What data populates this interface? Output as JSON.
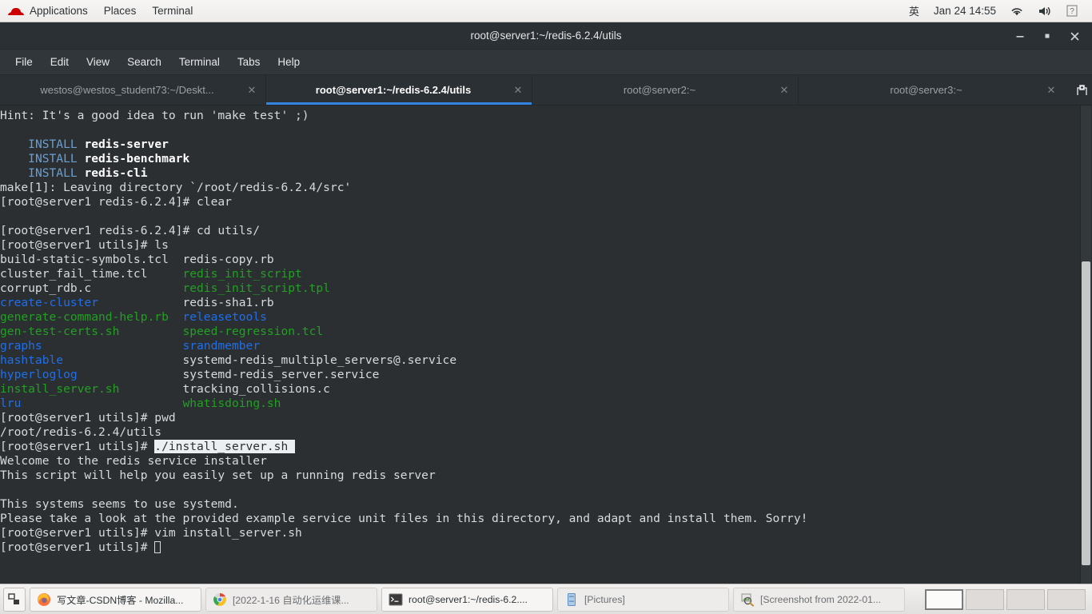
{
  "gnome_panel": {
    "logo": "redhat-logo",
    "menus": [
      "Applications",
      "Places",
      "Terminal"
    ],
    "ime": "英",
    "clock": "Jan 24 14:55",
    "tray_icons": [
      "wifi-icon",
      "volume-icon",
      "help-icon"
    ]
  },
  "window": {
    "title": "root@server1:~/redis-6.2.4/utils",
    "buttons": {
      "minimize": "_",
      "maximize": "□",
      "close": "✕"
    }
  },
  "menubar": [
    "File",
    "Edit",
    "View",
    "Search",
    "Terminal",
    "Tabs",
    "Help"
  ],
  "tabs": [
    {
      "label": "westos@westos_student73:~/Deskt...",
      "active": false
    },
    {
      "label": "root@server1:~/redis-6.2.4/utils",
      "active": true
    },
    {
      "label": "root@server2:~",
      "active": false
    },
    {
      "label": "root@server3:~",
      "active": false
    }
  ],
  "tab_actions": {
    "new_tab": "new-tab-icon",
    "tab_menu": "chevron-down-icon"
  },
  "terminal": {
    "lines": [
      [
        {
          "t": "Hint: It's a good idea to run 'make test' ;)"
        }
      ],
      [
        {
          "t": ""
        }
      ],
      [
        {
          "t": "    "
        },
        {
          "t": "INSTALL ",
          "c": "c-ltblue"
        },
        {
          "t": "redis-server",
          "c": "c-white b"
        }
      ],
      [
        {
          "t": "    "
        },
        {
          "t": "INSTALL ",
          "c": "c-ltblue"
        },
        {
          "t": "redis-benchmark",
          "c": "c-white b"
        }
      ],
      [
        {
          "t": "    "
        },
        {
          "t": "INSTALL ",
          "c": "c-ltblue"
        },
        {
          "t": "redis-cli",
          "c": "c-white b"
        }
      ],
      [
        {
          "t": "make[1]: Leaving directory `/root/redis-6.2.4/src'"
        }
      ],
      [
        {
          "t": "[root@server1 redis-6.2.4]# clear"
        }
      ],
      [
        {
          "t": ""
        }
      ],
      [
        {
          "t": "[root@server1 redis-6.2.4]# cd utils/"
        }
      ],
      [
        {
          "t": "[root@server1 utils]# ls"
        }
      ],
      [
        {
          "t": "build-static-symbols.tcl  redis-copy.rb"
        }
      ],
      [
        {
          "t": "cluster_fail_time.tcl     "
        },
        {
          "t": "redis_init_script",
          "c": "c-green"
        }
      ],
      [
        {
          "t": "corrupt_rdb.c             "
        },
        {
          "t": "redis_init_script.tpl",
          "c": "c-green"
        }
      ],
      [
        {
          "t": "create-cluster",
          "c": "c-blue"
        },
        {
          "t": "            redis-sha1.rb"
        }
      ],
      [
        {
          "t": "generate-command-help.rb",
          "c": "c-green"
        },
        {
          "t": "  "
        },
        {
          "t": "releasetools",
          "c": "c-blue"
        }
      ],
      [
        {
          "t": "gen-test-certs.sh",
          "c": "c-green"
        },
        {
          "t": "         "
        },
        {
          "t": "speed-regression.tcl",
          "c": "c-green"
        }
      ],
      [
        {
          "t": "graphs",
          "c": "c-blue"
        },
        {
          "t": "                    "
        },
        {
          "t": "srandmember",
          "c": "c-blue"
        }
      ],
      [
        {
          "t": "hashtable",
          "c": "c-blue"
        },
        {
          "t": "                 systemd-redis_multiple_servers@.service"
        }
      ],
      [
        {
          "t": "hyperloglog",
          "c": "c-blue"
        },
        {
          "t": "               systemd-redis_server.service"
        }
      ],
      [
        {
          "t": "install_server.sh",
          "c": "c-green"
        },
        {
          "t": "         tracking_collisions.c"
        }
      ],
      [
        {
          "t": "lru",
          "c": "c-blue"
        },
        {
          "t": "                       "
        },
        {
          "t": "whatisdoing.sh",
          "c": "c-green"
        }
      ],
      [
        {
          "t": "[root@server1 utils]# pwd"
        }
      ],
      [
        {
          "t": "/root/redis-6.2.4/utils"
        }
      ],
      [
        {
          "t": "[root@server1 utils]# "
        },
        {
          "t": "./install_server.sh ",
          "c": "sel"
        }
      ],
      [
        {
          "t": "Welcome to the redis service installer"
        }
      ],
      [
        {
          "t": "This script will help you easily set up a running redis server"
        }
      ],
      [
        {
          "t": ""
        }
      ],
      [
        {
          "t": "This systems seems to use systemd."
        }
      ],
      [
        {
          "t": "Please take a look at the provided example service unit files in this directory, and adapt and install them. Sorry!"
        }
      ],
      [
        {
          "t": "[root@server1 utils]# vim install_server.sh"
        }
      ],
      [
        {
          "t": "[root@server1 utils]# "
        },
        {
          "t": "",
          "cursor": true
        }
      ]
    ]
  },
  "taskbar": {
    "show_desktop": "show-desktop-icon",
    "tasks": [
      {
        "label": "写文章-CSDN博客 - Mozilla...",
        "icon": "firefox-icon",
        "active": true
      },
      {
        "label": "[2022-1-16 自动化运维课...",
        "icon": "chrome-icon",
        "active": false
      },
      {
        "label": "root@server1:~/redis-6.2....",
        "icon": "terminal-icon",
        "active": true
      },
      {
        "label": "[Pictures]",
        "icon": "files-icon",
        "active": false
      },
      {
        "label": "[Screenshot from 2022-01...",
        "icon": "image-viewer-icon",
        "active": false
      }
    ],
    "workspaces": [
      {
        "name": "workspace-1",
        "active": true
      },
      {
        "name": "workspace-2",
        "active": false
      },
      {
        "name": "workspace-3",
        "active": false
      },
      {
        "name": "workspace-4",
        "active": false
      }
    ]
  },
  "colors": {
    "accent_blue": "#3584e4",
    "dir_blue": "#1f6feb",
    "exec_green": "#22a022",
    "install_blue": "#6a9fd4",
    "terminal_bg": "#2b2f32",
    "terminal_fg": "#d8dadb",
    "selection_bg": "#eceff1"
  }
}
